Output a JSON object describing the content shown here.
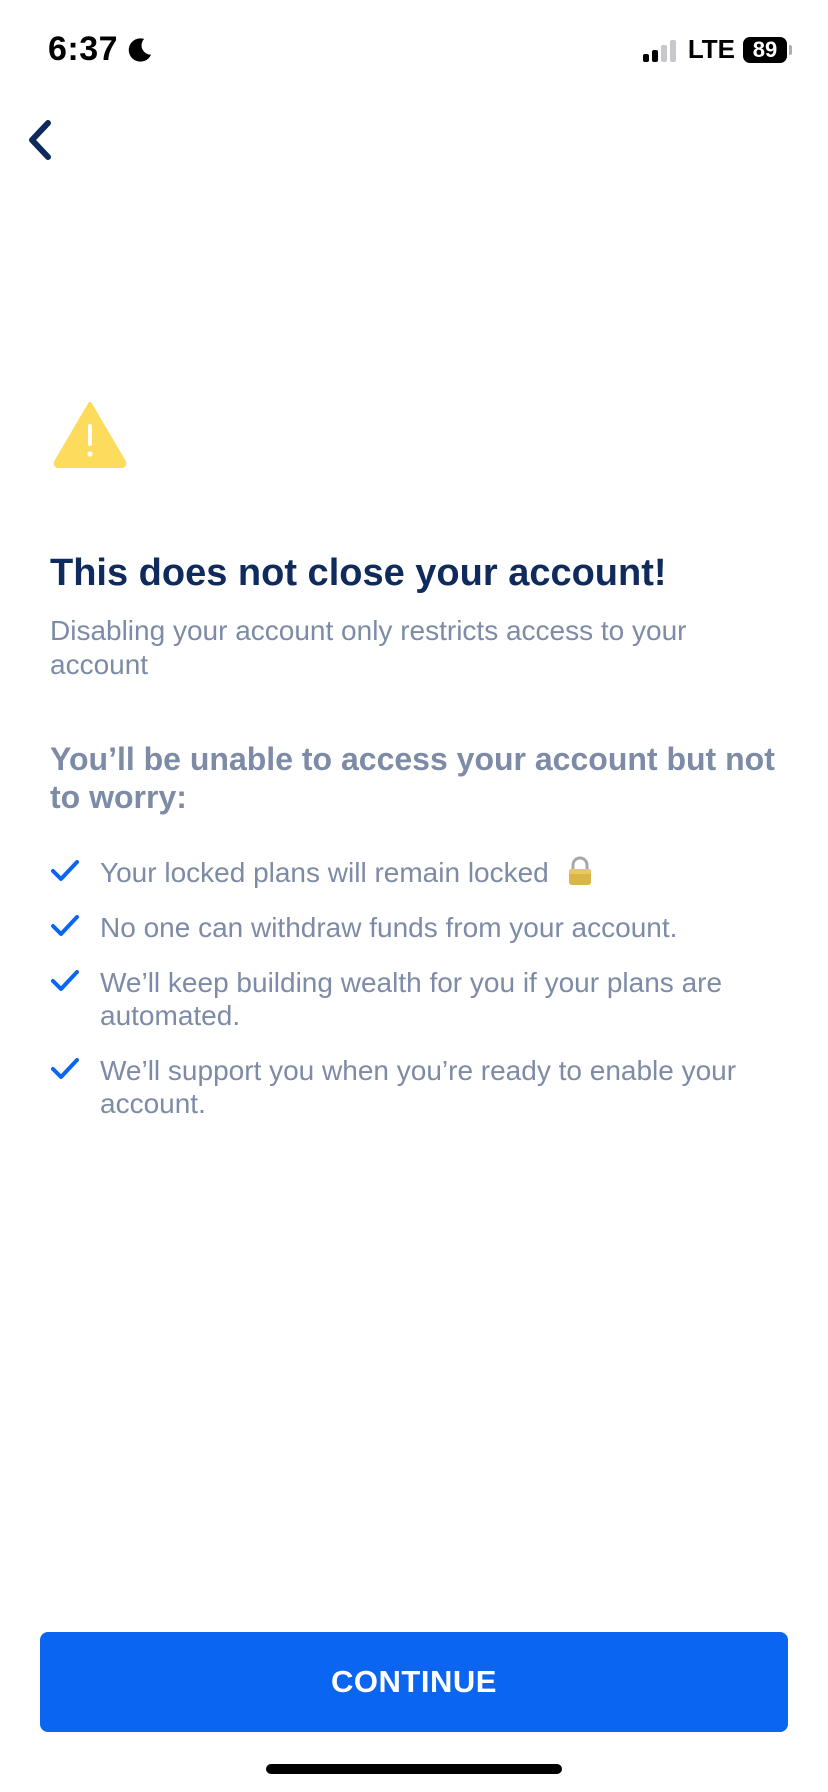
{
  "status_bar": {
    "time": "6:37",
    "network": "LTE",
    "battery": "89",
    "icons": [
      "moon-icon",
      "signal-icon",
      "battery-icon"
    ]
  },
  "header": {
    "back_icon": "chevron-left-icon"
  },
  "main": {
    "warning_icon": "warning-icon",
    "title": "This does not close your account!",
    "subtitle": "Disabling your account only restricts access to your account",
    "section_heading": "You’ll be unable to access your account but not to worry:",
    "benefits": [
      {
        "text": "Your locked plans will remain locked",
        "icon": "check-icon",
        "trailing_icon": "lock-icon"
      },
      {
        "text": "No one can withdraw funds from your account.",
        "icon": "check-icon"
      },
      {
        "text": "We’ll keep building wealth for you if your plans are automated.",
        "icon": "check-icon"
      },
      {
        "text": "We’ll support you when you’re ready to enable your account.",
        "icon": "check-icon"
      }
    ]
  },
  "footer": {
    "continue_label": "CONTINUE"
  },
  "colors": {
    "primary": "#0a66f0",
    "title": "#0f2a5c",
    "muted": "#7d8ba6",
    "warning": "#fddb5c"
  }
}
